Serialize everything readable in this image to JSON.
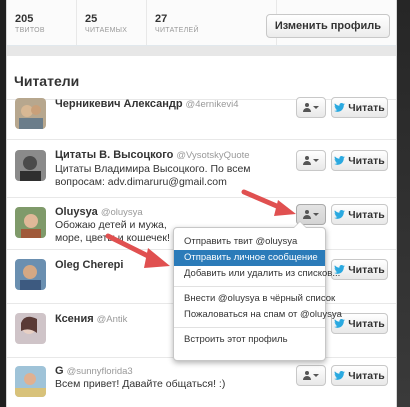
{
  "stats": [
    {
      "num": "205",
      "label": "ТВИТОВ"
    },
    {
      "num": "25",
      "label": "ЧИТАЕМЫХ"
    },
    {
      "num": "27",
      "label": "ЧИТАТЕЛЕЙ"
    }
  ],
  "edit_profile_label": "Изменить профиль",
  "section_title": "Читатели",
  "follow_label": "Читать",
  "followers": [
    {
      "name": "Черникевич Александр",
      "handle": "@4ernikevi4",
      "bio": ""
    },
    {
      "name": "Цитаты В. Высоцкого",
      "handle": "@VysotskyQuote",
      "bio": "Цитаты Владимира Высоцкого. По всем вопросам: adv.dimaruru@gmail.com"
    },
    {
      "name": "Oluysya",
      "handle": "@oluysya",
      "bio": "Обожаю детей и мужа, море, цветы и кошечек!"
    },
    {
      "name": "Oleg Cherepi",
      "handle": "",
      "bio": ""
    },
    {
      "name": "Ксения",
      "handle": "@Antik",
      "bio": ""
    },
    {
      "name": "G",
      "handle": "@sunnyflorida3",
      "bio": "Всем привет! Давайте общаться! :)"
    }
  ],
  "dropdown": {
    "group1": [
      "Отправить твит @oluysya",
      "Отправить личное сообщение",
      "Добавить или удалить из списков..."
    ],
    "group2": [
      "Внести @oluysya в чёрный список",
      "Пожаловаться на спам от @oluysya"
    ],
    "group3": [
      "Встроить этот профиль"
    ],
    "highlighted_index": 1
  },
  "colors": {
    "accent": "#2b7bb9",
    "bird": "#2aa9e0",
    "arrow": "#e05050"
  }
}
